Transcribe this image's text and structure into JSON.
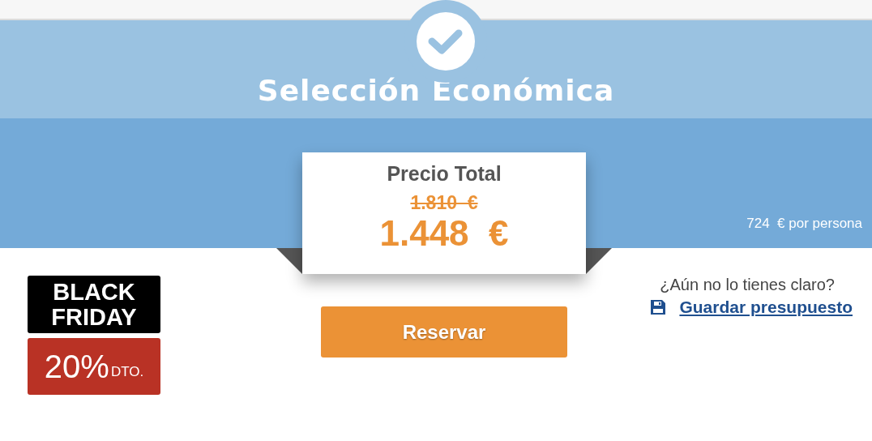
{
  "title": "Selección Económica",
  "price": {
    "label": "Precio Total",
    "old_price": "1.810  €",
    "new_price": "1.448  €"
  },
  "per_person": {
    "amount": "724",
    "unit": "€ por persona"
  },
  "badge": {
    "line_1": "BLACK",
    "line_2": "FRIDAY",
    "percent": "20%",
    "suffix": "DTO."
  },
  "book_button": "Reservar",
  "save": {
    "question": "¿Aún no lo tienes claro?",
    "link": "Guardar presupuesto"
  }
}
